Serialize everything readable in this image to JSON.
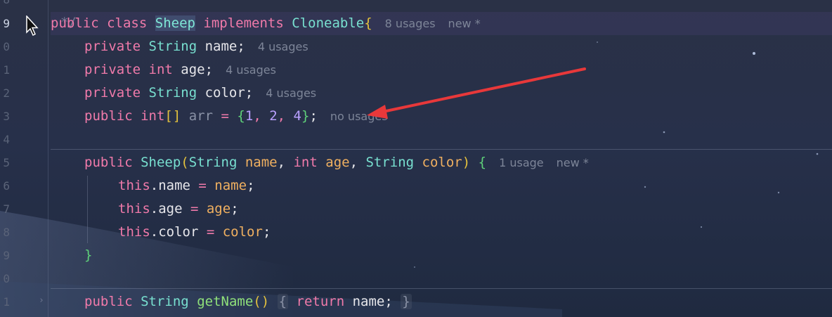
{
  "gutter": {
    "lines": [
      "8",
      "9",
      "0",
      "1",
      "2",
      "3",
      "4",
      "5",
      "6",
      "7",
      "8",
      "9",
      "0",
      "1"
    ],
    "current_line_label": "9"
  },
  "code": {
    "top_fragment": "*/",
    "class_decl": {
      "kw1": "public",
      "kw2": "class",
      "name": "Sheep",
      "kw3": "implements",
      "iface": "Cloneable",
      "brace": "{",
      "hint_usages": "8 usages",
      "hint_new": "new *"
    },
    "field_name": {
      "kw": "private",
      "type": "String",
      "rest": " name;",
      "hint": "4 usages"
    },
    "field_age": {
      "kw": "private",
      "type": "int",
      "rest": " age;",
      "hint": "4 usages"
    },
    "field_color": {
      "kw": "private",
      "type": "String",
      "rest": " color;",
      "hint": "4 usages"
    },
    "field_arr": {
      "kw": "public",
      "type": "int",
      "brackets": "[]",
      "name": " arr",
      "eq": " = ",
      "open": "{",
      "n1": "1",
      "n2": "2",
      "n3": "4",
      "close": "}",
      "semi": ";",
      "comma": ", ",
      "hint": "no usages"
    },
    "ctor": {
      "kw": "public",
      "name": "Sheep",
      "lp": "(",
      "t1": "String",
      "p1": " name",
      "t2": "int",
      "p2": " age",
      "t3": "String",
      "p3": " color",
      "rp": ")",
      "brace": " {",
      "hint_usages": "1 usage",
      "hint_new": "new *",
      "comma": ", "
    },
    "assign_name": {
      "this": "this",
      "field": ".name",
      "eq": " = ",
      "val": "name",
      "semi": ";"
    },
    "assign_age": {
      "this": "this",
      "field": ".age",
      "eq": " = ",
      "val": "age",
      "semi": ";"
    },
    "assign_color": {
      "this": "this",
      "field": ".color",
      "eq": " = ",
      "val": "color",
      "semi": ";"
    },
    "ctor_close": "}",
    "getter": {
      "kw": "public",
      "type": "String",
      "name": "getName",
      "parens": "()",
      "open": "{",
      "ret": "return",
      "body": " name;",
      "close": "}"
    }
  },
  "colors": {
    "keyword": "#f07aaa",
    "type": "#78e0d0",
    "number": "#b9a0ff",
    "string_param": "#f0b060",
    "annotation_arrow": "#e8383a"
  }
}
